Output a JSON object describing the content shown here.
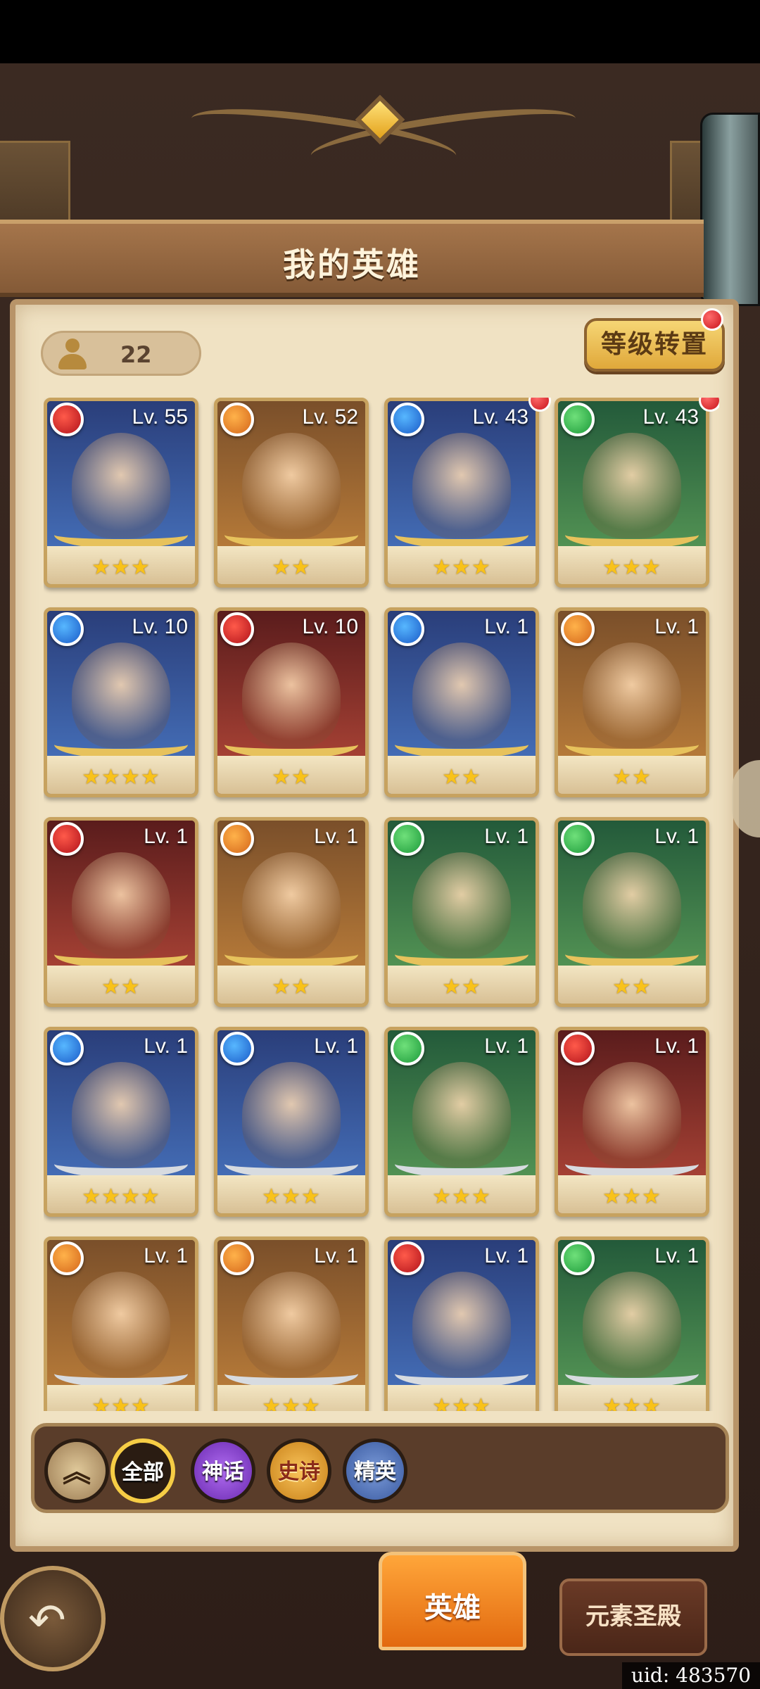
{
  "header": {
    "title": "我的英雄"
  },
  "hero_count": "22",
  "level_transfer_label": "等级转置",
  "heroes": [
    {
      "level": "Lv. 55",
      "element": "fire",
      "stars": "★★★",
      "theme": "blue",
      "badge": false
    },
    {
      "level": "Lv. 52",
      "element": "earth",
      "stars": "★★",
      "theme": "gold",
      "badge": false
    },
    {
      "level": "Lv. 43",
      "element": "water",
      "stars": "★★★",
      "theme": "blue",
      "badge": true
    },
    {
      "level": "Lv. 43",
      "element": "nature",
      "stars": "★★★",
      "theme": "green",
      "badge": true
    },
    {
      "level": "Lv. 10",
      "element": "water",
      "stars": "★★★★",
      "theme": "blue",
      "badge": false
    },
    {
      "level": "Lv. 10",
      "element": "fire",
      "stars": "★★",
      "theme": "red",
      "badge": false
    },
    {
      "level": "Lv. 1",
      "element": "water",
      "stars": "★★",
      "theme": "blue",
      "badge": false
    },
    {
      "level": "Lv. 1",
      "element": "earth",
      "stars": "★★",
      "theme": "gold",
      "badge": false
    },
    {
      "level": "Lv. 1",
      "element": "fire",
      "stars": "★★",
      "theme": "red",
      "badge": false
    },
    {
      "level": "Lv. 1",
      "element": "earth",
      "stars": "★★",
      "theme": "gold",
      "badge": false
    },
    {
      "level": "Lv. 1",
      "element": "nature",
      "stars": "★★",
      "theme": "green",
      "badge": false
    },
    {
      "level": "Lv. 1",
      "element": "nature",
      "stars": "★★",
      "theme": "green",
      "badge": false
    },
    {
      "level": "Lv. 1",
      "element": "water",
      "stars": "★★★★",
      "theme": "blue",
      "badge": false
    },
    {
      "level": "Lv. 1",
      "element": "water",
      "stars": "★★★",
      "theme": "blue",
      "badge": false
    },
    {
      "level": "Lv. 1",
      "element": "nature",
      "stars": "★★★",
      "theme": "green",
      "badge": false
    },
    {
      "level": "Lv. 1",
      "element": "fire",
      "stars": "★★★",
      "theme": "red",
      "badge": false
    },
    {
      "level": "Lv. 1",
      "element": "earth",
      "stars": "★★★",
      "theme": "gold",
      "badge": false
    },
    {
      "level": "Lv. 1",
      "element": "earth",
      "stars": "★★★",
      "theme": "gold",
      "badge": false
    },
    {
      "level": "Lv. 1",
      "element": "fire",
      "stars": "★★★",
      "theme": "blue",
      "badge": false
    },
    {
      "level": "Lv. 1",
      "element": "nature",
      "stars": "★★★",
      "theme": "green",
      "badge": false
    }
  ],
  "filters": {
    "all": "全部",
    "myth": "神话",
    "epic": "史诗",
    "elite": "精英"
  },
  "tabs": {
    "hero": "英雄",
    "temple": "元素圣殿"
  },
  "uid_text": "uid: 483570",
  "colors": {
    "accent_orange": "#e2690f",
    "panel_parchment": "#f0e2c3",
    "frame_gold": "#c7a25f",
    "badge_red": "#c8141a"
  }
}
